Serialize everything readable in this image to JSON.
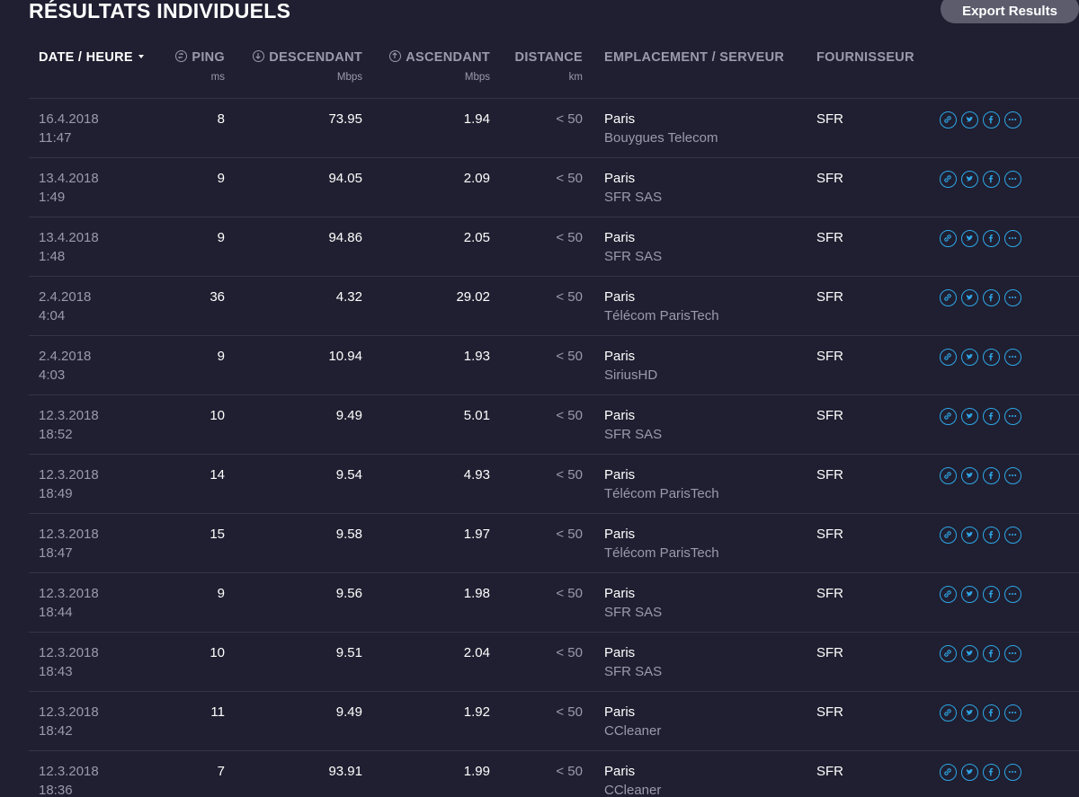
{
  "page": {
    "title": "RÉSULTATS INDIVIDUELS",
    "export_label": "Export Results"
  },
  "header": {
    "date": "DATE / HEURE",
    "ping": "PING",
    "ping_unit": "ms",
    "download": "DESCENDANT",
    "download_unit": "Mbps",
    "upload": "ASCENDANT",
    "upload_unit": "Mbps",
    "distance": "DISTANCE",
    "distance_unit": "km",
    "location": "EMPLACEMENT / SERVEUR",
    "provider": "FOURNISSEUR"
  },
  "accent_color": "#2fa6e6",
  "action_icons": [
    "link-icon",
    "twitter-icon",
    "facebook-icon",
    "more-icon"
  ],
  "rows": [
    {
      "date": "16.4.2018",
      "time": "11:47",
      "ping": "8",
      "download": "73.95",
      "upload": "1.94",
      "distance": "< 50",
      "city": "Paris",
      "server": "Bouygues Telecom",
      "provider": "SFR"
    },
    {
      "date": "13.4.2018",
      "time": "1:49",
      "ping": "9",
      "download": "94.05",
      "upload": "2.09",
      "distance": "< 50",
      "city": "Paris",
      "server": "SFR SAS",
      "provider": "SFR"
    },
    {
      "date": "13.4.2018",
      "time": "1:48",
      "ping": "9",
      "download": "94.86",
      "upload": "2.05",
      "distance": "< 50",
      "city": "Paris",
      "server": "SFR SAS",
      "provider": "SFR"
    },
    {
      "date": "2.4.2018",
      "time": "4:04",
      "ping": "36",
      "download": "4.32",
      "upload": "29.02",
      "distance": "< 50",
      "city": "Paris",
      "server": "Télécom ParisTech",
      "provider": "SFR"
    },
    {
      "date": "2.4.2018",
      "time": "4:03",
      "ping": "9",
      "download": "10.94",
      "upload": "1.93",
      "distance": "< 50",
      "city": "Paris",
      "server": "SiriusHD",
      "provider": "SFR"
    },
    {
      "date": "12.3.2018",
      "time": "18:52",
      "ping": "10",
      "download": "9.49",
      "upload": "5.01",
      "distance": "< 50",
      "city": "Paris",
      "server": "SFR SAS",
      "provider": "SFR"
    },
    {
      "date": "12.3.2018",
      "time": "18:49",
      "ping": "14",
      "download": "9.54",
      "upload": "4.93",
      "distance": "< 50",
      "city": "Paris",
      "server": "Télécom ParisTech",
      "provider": "SFR"
    },
    {
      "date": "12.3.2018",
      "time": "18:47",
      "ping": "15",
      "download": "9.58",
      "upload": "1.97",
      "distance": "< 50",
      "city": "Paris",
      "server": "Télécom ParisTech",
      "provider": "SFR"
    },
    {
      "date": "12.3.2018",
      "time": "18:44",
      "ping": "9",
      "download": "9.56",
      "upload": "1.98",
      "distance": "< 50",
      "city": "Paris",
      "server": "SFR SAS",
      "provider": "SFR"
    },
    {
      "date": "12.3.2018",
      "time": "18:43",
      "ping": "10",
      "download": "9.51",
      "upload": "2.04",
      "distance": "< 50",
      "city": "Paris",
      "server": "SFR SAS",
      "provider": "SFR"
    },
    {
      "date": "12.3.2018",
      "time": "18:42",
      "ping": "11",
      "download": "9.49",
      "upload": "1.92",
      "distance": "< 50",
      "city": "Paris",
      "server": "CCleaner",
      "provider": "SFR"
    },
    {
      "date": "12.3.2018",
      "time": "18:36",
      "ping": "7",
      "download": "93.91",
      "upload": "1.99",
      "distance": "< 50",
      "city": "Paris",
      "server": "CCleaner",
      "provider": "SFR"
    }
  ]
}
